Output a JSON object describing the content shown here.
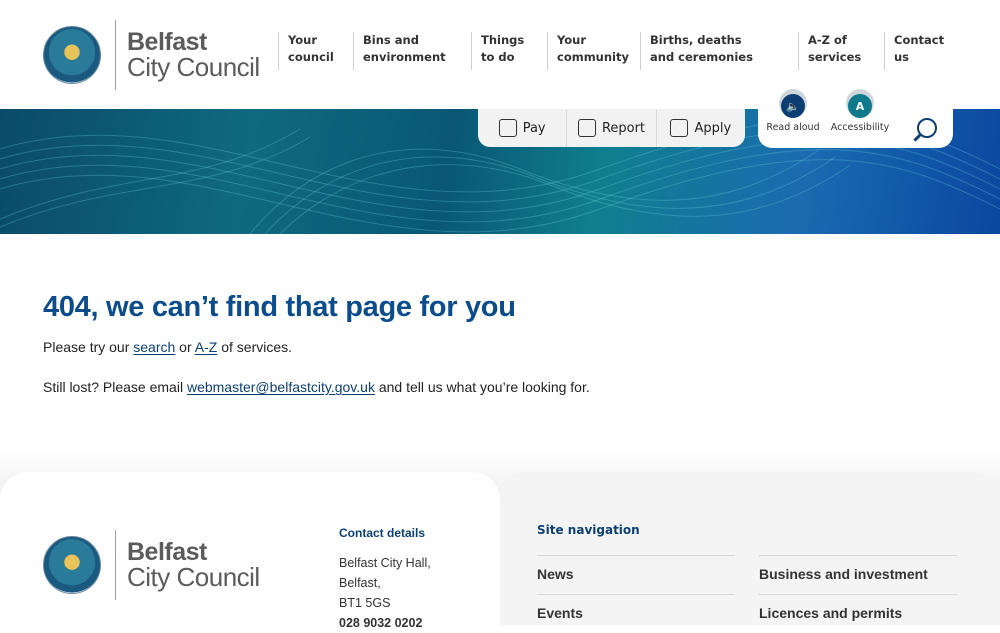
{
  "logo": {
    "line1": "Belfast",
    "line2": "City Council"
  },
  "nav": [
    {
      "label": "Your council"
    },
    {
      "label": "Bins and environment"
    },
    {
      "label": "Things to do"
    },
    {
      "label": "Your community"
    },
    {
      "label": "Births, deaths and ceremonies"
    },
    {
      "label": "A-Z of services"
    },
    {
      "label": "Contact us"
    }
  ],
  "tabs": [
    {
      "label": "Pay",
      "icon": "pay-icon"
    },
    {
      "label": "Report",
      "icon": "report-icon"
    },
    {
      "label": "Apply",
      "icon": "apply-icon"
    }
  ],
  "util": {
    "read_aloud": {
      "label": "Read aloud",
      "icon": "speaker-icon",
      "color": "#0b3f74"
    },
    "accessibility": {
      "label": "Accessibility",
      "icon_text": "A",
      "color": "#0f7a8c"
    }
  },
  "main": {
    "title": "404, we can’t find that page for you",
    "line1_pre": "Please try our ",
    "search_link": "search",
    "line1_mid": " or ",
    "az_link": "A-Z",
    "line1_post": " of services.",
    "line2_pre": "Still lost? Please email ",
    "email_link": "webmaster@belfastcity.gov.uk",
    "line2_post": " and tell us what you’re looking for."
  },
  "footer": {
    "contact_heading": "Contact details",
    "contact_lines": [
      "Belfast City Hall,",
      "Belfast,",
      "BT1 5GS",
      "028 9032 0202"
    ],
    "sitenav_heading": "Site navigation",
    "sitenav": [
      "News",
      "Business and investment",
      "Events",
      "Licences and permits"
    ]
  },
  "colors": {
    "brand_blue": "#0b4c8c",
    "teal": "#0f7a8c"
  }
}
